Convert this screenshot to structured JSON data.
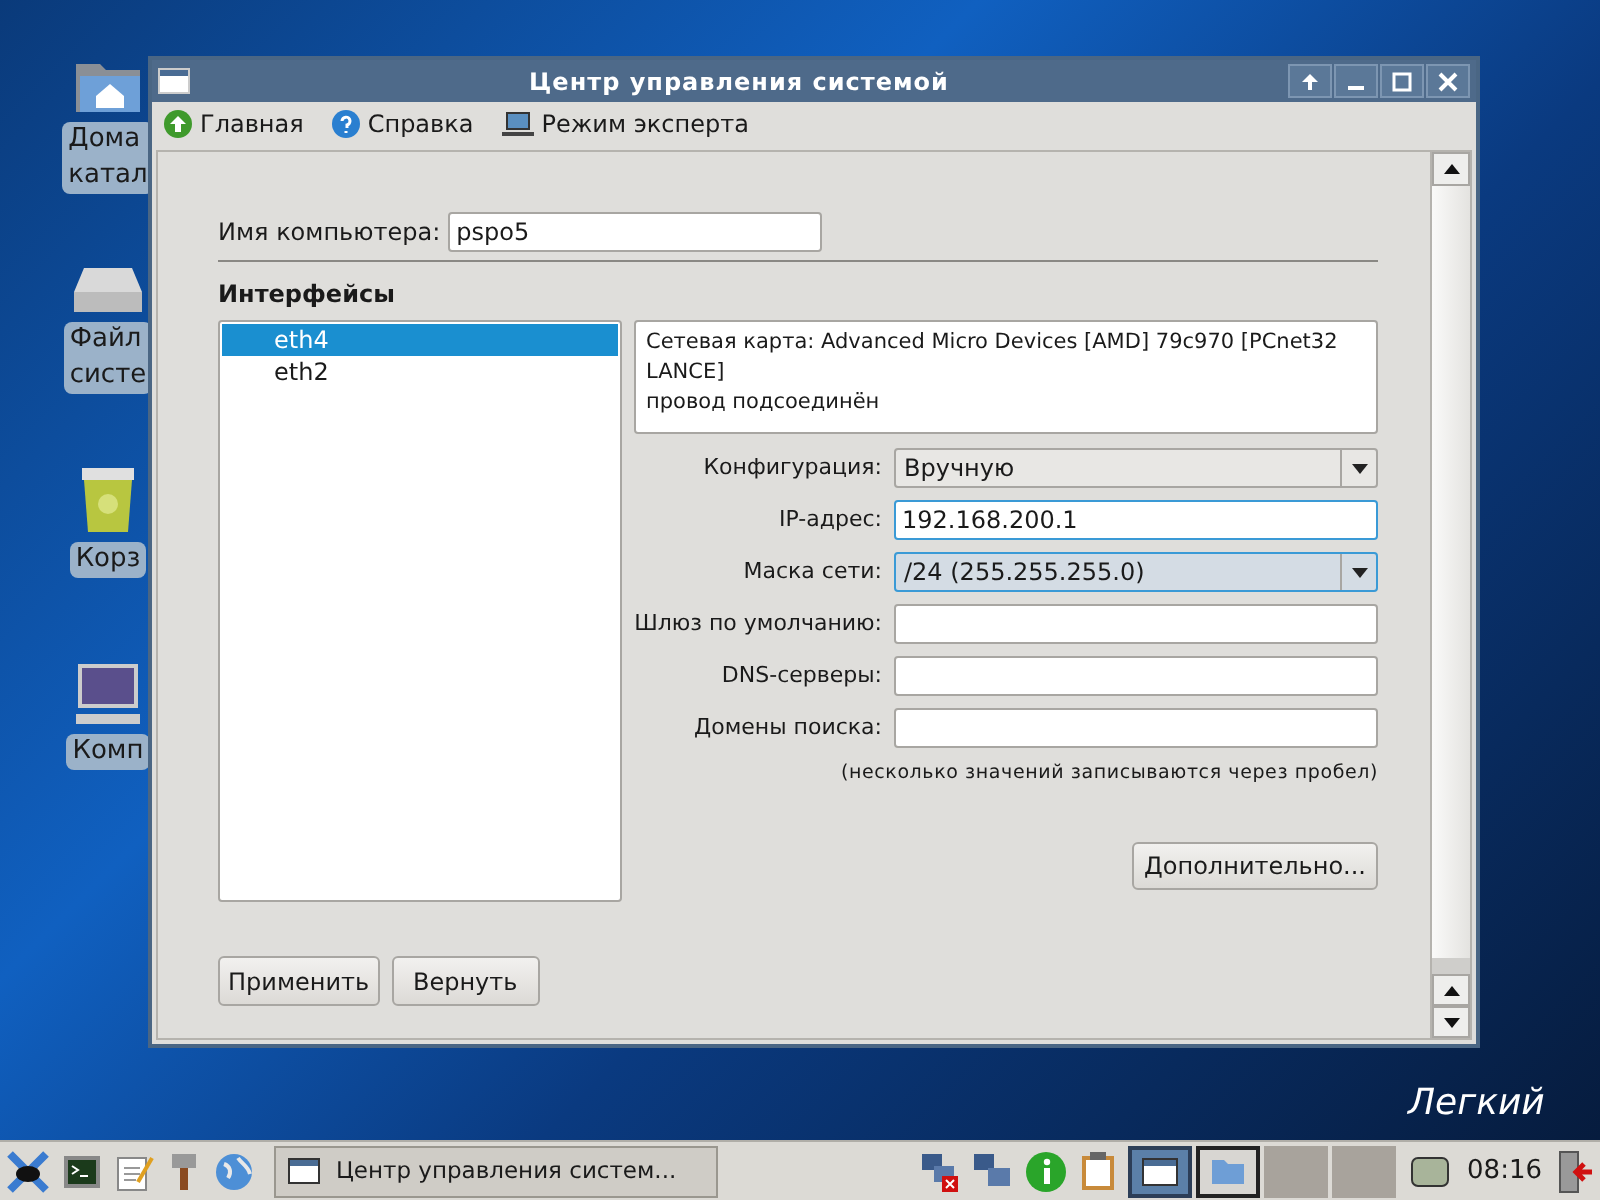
{
  "desktop": {
    "icons": [
      {
        "kind": "home",
        "label": "Дома\nкатал"
      },
      {
        "kind": "drive",
        "label": "Файл\nсисте"
      },
      {
        "kind": "trash",
        "label": "Корз"
      },
      {
        "kind": "computer",
        "label": "Комп"
      }
    ],
    "wallpaper_caption": "Легкий"
  },
  "window": {
    "title": "Центр управления системой",
    "toolbar": [
      {
        "kind": "home",
        "label": "Главная"
      },
      {
        "kind": "help",
        "label": "Справка"
      },
      {
        "kind": "expert",
        "label": "Режим эксперта"
      }
    ],
    "hostname": {
      "label": "Имя компьютера:",
      "value": "pspo5"
    },
    "interfaces": {
      "title": "Интерфейсы",
      "items": [
        {
          "label": "eth4",
          "selected": true
        },
        {
          "label": "eth2",
          "selected": false
        }
      ]
    },
    "info": "Сетевая карта: Advanced Micro Devices [AMD] 79c970 [PCnet32 LANCE]\nпровод подсоединён",
    "fields": [
      {
        "kind": "select",
        "label": "Конфигурация:",
        "value": "Вручную",
        "focused": false
      },
      {
        "kind": "input",
        "label": "IP-адрес:",
        "value": "192.168.200.1",
        "focused": true
      },
      {
        "kind": "select",
        "label": "Маска сети:",
        "value": "/24 (255.255.255.0)",
        "focused": true
      },
      {
        "kind": "input",
        "label": "Шлюз по умолчанию:",
        "focused": false
      },
      {
        "kind": "input",
        "label": "DNS-серверы:",
        "focused": false
      },
      {
        "kind": "input",
        "label": "Домены поиска:",
        "focused": false
      }
    ],
    "hint": "(несколько значений записываются через пробел)",
    "advanced_button": "Дополнительно...",
    "buttons": [
      "Применить",
      "Вернуть"
    ]
  },
  "taskbar": {
    "launchers": [
      {
        "kind": "start"
      },
      {
        "kind": "terminal"
      },
      {
        "kind": "notepad"
      },
      {
        "kind": "brush"
      },
      {
        "kind": "globe"
      }
    ],
    "task": "Центр управления систем...",
    "tray": [
      {
        "kind": "net-error"
      },
      {
        "kind": "net"
      },
      {
        "kind": "info"
      },
      {
        "kind": "clipboard"
      }
    ],
    "workspaces": [
      {
        "kind": "window",
        "selected": true
      },
      {
        "kind": "folder",
        "selected": false
      },
      {
        "kind": "empty",
        "selected": false
      },
      {
        "kind": "empty",
        "selected": false
      }
    ],
    "clock": "08:16"
  }
}
